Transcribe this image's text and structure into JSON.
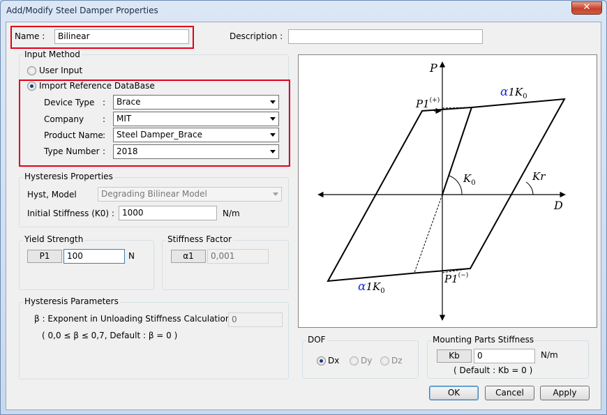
{
  "window": {
    "title": "Add/Modify Steel Damper Properties",
    "close_glyph": "✕"
  },
  "name": {
    "label": "Name :",
    "value": "Bilinear"
  },
  "description": {
    "label": "Description :",
    "value": ""
  },
  "input_method": {
    "title": "Input Method",
    "user_input_label": "User Input",
    "import_label": "Import Reference DataBase",
    "selected": "import",
    "device_type": {
      "label": "Device Type",
      "value": "Brace"
    },
    "company": {
      "label": "Company",
      "value": "MIT"
    },
    "product_name": {
      "label": "Product Name",
      "value": "Steel Damper_Brace"
    },
    "type_number": {
      "label": "Type Number",
      "value": "2018"
    },
    "colon": ":"
  },
  "hysteresis_properties": {
    "title": "Hysteresis Properties",
    "model_label": "Hyst, Model",
    "model_value": "Degrading Bilinear Model",
    "stiffness_label": "Initial Stiffness (K0) :",
    "stiffness_value": "1000",
    "stiffness_unit": "N/m"
  },
  "yield_strength": {
    "title": "Yield Strength",
    "tag": "P1",
    "value": "100",
    "unit": "N"
  },
  "stiffness_factor": {
    "title": "Stiffness Factor",
    "tag": "α1",
    "value": "0,001"
  },
  "hysteresis_parameters": {
    "title": "Hysteresis Parameters",
    "beta_label": "β : Exponent in Unloading Stiffness Calculation :",
    "beta_value": "0",
    "beta_note": "( 0,0 ≤ β ≤ 0,7, Default : β = 0 )"
  },
  "dof": {
    "title": "DOF",
    "options": [
      "Dx",
      "Dy",
      "Dz"
    ],
    "selected": "Dx"
  },
  "mounting": {
    "title": "Mounting Parts Stiffness",
    "tag": "Kb",
    "value": "0",
    "unit": "N/m",
    "note": "( Default : Kb = 0 )"
  },
  "buttons": {
    "ok": "OK",
    "cancel": "Cancel",
    "apply": "Apply"
  },
  "diagram_labels": {
    "p": "P",
    "d": "D",
    "k0": "K",
    "k0_sub": "0",
    "kr": "Kr",
    "p1_pos": "P1",
    "p1_pos_sup": "(+)",
    "p1_neg": "P1",
    "p1_neg_sup": "(−)",
    "alpha_top": "α",
    "alpha_top_rest": "1K",
    "alpha_top_sub": "0",
    "alpha_bottom": "α",
    "alpha_bottom_rest": "1K",
    "alpha_bottom_sub": "0"
  },
  "colors": {
    "highlight": "#e0001a",
    "alpha_symbol": "#1f2fd0"
  }
}
